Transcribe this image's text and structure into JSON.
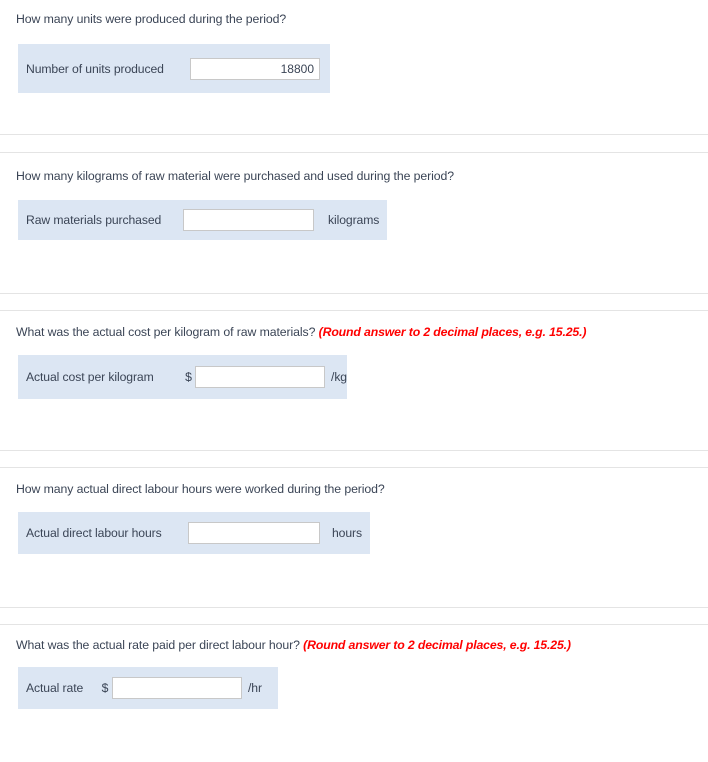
{
  "questions": [
    {
      "prompt": "How many units were produced during the period?",
      "hint": "",
      "label": "Number of units produced",
      "currency": "",
      "value": "18800",
      "placeholder": "",
      "unit": ""
    },
    {
      "prompt": "How many kilograms of raw material were purchased and used during the period?",
      "hint": "",
      "label": "Raw materials purchased",
      "currency": "",
      "value": "",
      "placeholder": "",
      "unit": "kilograms"
    },
    {
      "prompt": "What was the actual cost per kilogram of raw materials?",
      "hint": "(Round answer to 2 decimal places, e.g. 15.25.)",
      "label": "Actual cost per kilogram",
      "currency": "$",
      "value": "",
      "placeholder": "",
      "unit": "/kg"
    },
    {
      "prompt": "How many actual direct labour hours were worked during the period?",
      "hint": "",
      "label": "Actual direct labour hours",
      "currency": "",
      "value": "",
      "placeholder": "",
      "unit": "hours"
    },
    {
      "prompt": "What was the actual rate paid per direct labour hour?",
      "hint": "(Round answer to 2 decimal places, e.g. 15.25.)",
      "label": "Actual rate",
      "currency": "$",
      "value": "",
      "placeholder": "",
      "unit": "/hr"
    }
  ],
  "colors": {
    "panel_background": "#dce6f3",
    "text": "#3b4556",
    "hint": "#ff0000",
    "divider": "#e4e4e4",
    "input_border": "#c8c8c8"
  }
}
